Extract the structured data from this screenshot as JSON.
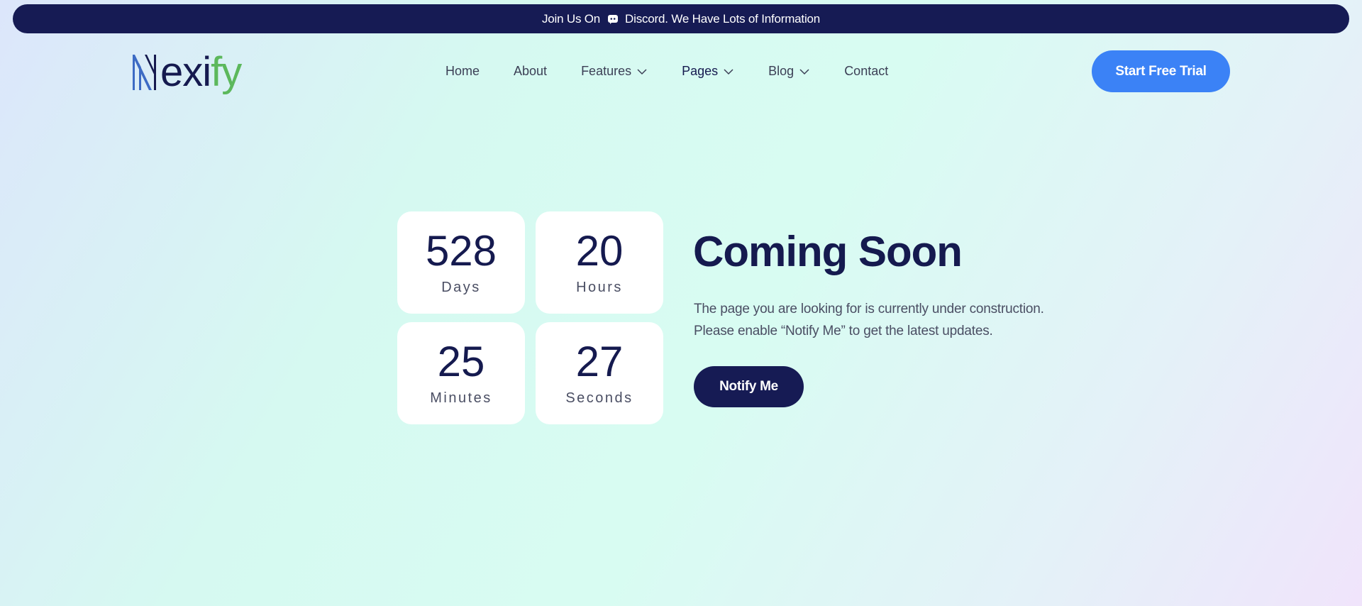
{
  "topbar": {
    "prefix": "Join Us On",
    "suffix": "Discord. We Have Lots of Information",
    "icon": "discord-icon"
  },
  "brand": {
    "logo_initial": "N",
    "logo_part1": "exi",
    "logo_part2": "fy",
    "colors": {
      "dark": "#151a4f",
      "green": "#5cb85c",
      "blue": "#3d6bc4"
    }
  },
  "nav": {
    "items": [
      {
        "label": "Home",
        "has_dropdown": false
      },
      {
        "label": "About",
        "has_dropdown": false
      },
      {
        "label": "Features",
        "has_dropdown": true
      },
      {
        "label": "Pages",
        "has_dropdown": true
      },
      {
        "label": "Blog",
        "has_dropdown": true
      },
      {
        "label": "Contact",
        "has_dropdown": false
      }
    ]
  },
  "cta": {
    "label": "Start Free Trial",
    "color": "#3b82f6"
  },
  "countdown": [
    {
      "value": "528",
      "label": "Days"
    },
    {
      "value": "20",
      "label": "Hours"
    },
    {
      "value": "25",
      "label": "Minutes"
    },
    {
      "value": "27",
      "label": "Seconds"
    }
  ],
  "hero": {
    "title": "Coming Soon",
    "line1": "The page you are looking for is currently under construction.",
    "line2": "Please enable “Notify Me” to get the latest updates.",
    "button": "Notify Me"
  }
}
